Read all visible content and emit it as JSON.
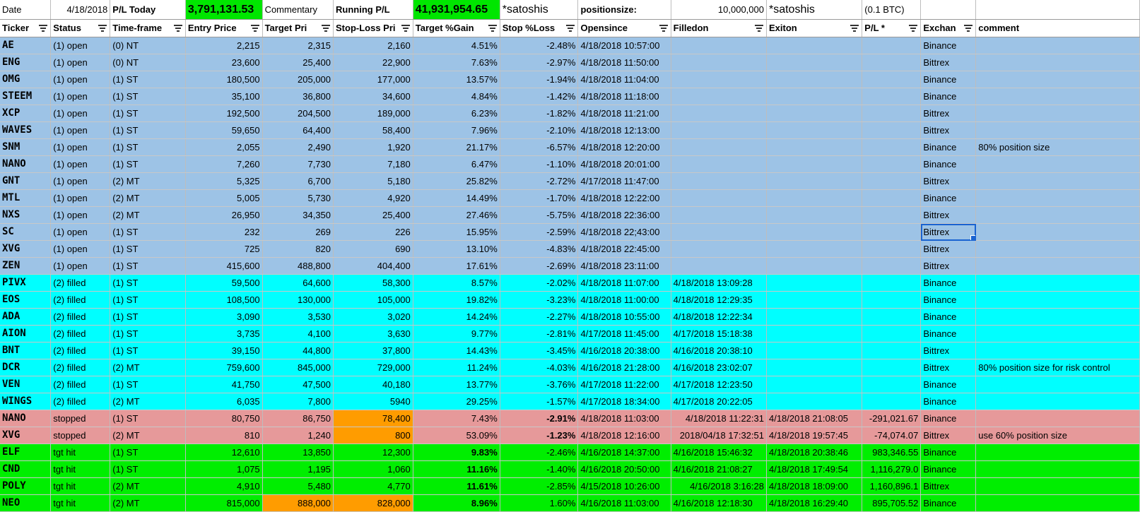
{
  "topbar": {
    "date_label": "Date",
    "date_value": "4/18/2018",
    "pl_today_label": "P/L Today",
    "pl_today_value": "3,791,131.53",
    "commentary_label": "Commentary",
    "running_pl_label": "Running P/L",
    "running_pl_value": "41,931,954.65",
    "satoshis_label_1": "*satoshis",
    "positionsize_label": "positionsize:",
    "positionsize_value": "10,000,000",
    "satoshis_label_2": "*satoshis",
    "btc_note": "(0.1 BTC)"
  },
  "colors": {
    "open": "#9dc3e6",
    "filled": "#00ffff",
    "stopped": "#e6999a",
    "tgt_hit": "#00ee00",
    "highlight": "#ff9c00",
    "header_green": "#00e600",
    "selection": "#1a63d1"
  },
  "headers": [
    "Ticker",
    "Status",
    "Time-frame",
    "Entry Price",
    "Target Pri",
    "Stop-Loss Pri",
    "Target %Gain",
    "Stop %Loss",
    "Opensince",
    "Filledon",
    "Exiton",
    "P/L *",
    "Exchan",
    "comment"
  ],
  "filter_icon": "autofilter-dropdown-icon",
  "rows": [
    {
      "ticker": "AE",
      "status": "(1) open",
      "timeframe": "(0) NT",
      "entry": "2,215",
      "target": "2,315",
      "stop": "2,160",
      "tgain": "4.51%",
      "sloss": "-2.48%",
      "opensince": "4/18/2018 10:57:00",
      "filledon": "",
      "exiton": "",
      "pl": "",
      "exchange": "Binance",
      "comment": ""
    },
    {
      "ticker": "ENG",
      "status": "(1) open",
      "timeframe": "(0) NT",
      "entry": "23,600",
      "target": "25,400",
      "stop": "22,900",
      "tgain": "7.63%",
      "sloss": "-2.97%",
      "opensince": "4/18/2018 11:50:00",
      "filledon": "",
      "exiton": "",
      "pl": "",
      "exchange": "Bittrex",
      "comment": ""
    },
    {
      "ticker": "OMG",
      "status": "(1) open",
      "timeframe": "(1) ST",
      "entry": "180,500",
      "target": "205,000",
      "stop": "177,000",
      "tgain": "13.57%",
      "sloss": "-1.94%",
      "opensince": "4/18/2018 11:04:00",
      "filledon": "",
      "exiton": "",
      "pl": "",
      "exchange": "Binance",
      "comment": ""
    },
    {
      "ticker": "STEEM",
      "status": "(1) open",
      "timeframe": "(1) ST",
      "entry": "35,100",
      "target": "36,800",
      "stop": "34,600",
      "tgain": "4.84%",
      "sloss": "-1.42%",
      "opensince": "4/18/2018 11:18:00",
      "filledon": "",
      "exiton": "",
      "pl": "",
      "exchange": "Binance",
      "comment": ""
    },
    {
      "ticker": "XCP",
      "status": "(1) open",
      "timeframe": "(1) ST",
      "entry": "192,500",
      "target": "204,500",
      "stop": "189,000",
      "tgain": "6.23%",
      "sloss": "-1.82%",
      "opensince": "4/18/2018 11:21:00",
      "filledon": "",
      "exiton": "",
      "pl": "",
      "exchange": "Bittrex",
      "comment": ""
    },
    {
      "ticker": "WAVES",
      "status": "(1) open",
      "timeframe": "(1) ST",
      "entry": "59,650",
      "target": "64,400",
      "stop": "58,400",
      "tgain": "7.96%",
      "sloss": "-2.10%",
      "opensince": "4/18/2018 12:13:00",
      "filledon": "",
      "exiton": "",
      "pl": "",
      "exchange": "Bittrex",
      "comment": ""
    },
    {
      "ticker": "SNM",
      "status": "(1) open",
      "timeframe": "(1) ST",
      "entry": "2,055",
      "target": "2,490",
      "stop": "1,920",
      "tgain": "21.17%",
      "sloss": "-6.57%",
      "opensince": "4/18/2018 12:20:00",
      "filledon": "",
      "exiton": "",
      "pl": "",
      "exchange": "Binance",
      "comment": "80% position size"
    },
    {
      "ticker": "NANO",
      "status": "(1) open",
      "timeframe": "(1) ST",
      "entry": "7,260",
      "target": "7,730",
      "stop": "7,180",
      "tgain": "6.47%",
      "sloss": "-1.10%",
      "opensince": "4/18/2018 20:01:00",
      "filledon": "",
      "exiton": "",
      "pl": "",
      "exchange": "Binance",
      "comment": ""
    },
    {
      "ticker": "GNT",
      "status": "(1) open",
      "timeframe": "(2) MT",
      "entry": "5,325",
      "target": "6,700",
      "stop": "5,180",
      "tgain": "25.82%",
      "sloss": "-2.72%",
      "opensince": "4/17/2018 11:47:00",
      "filledon": "",
      "exiton": "",
      "pl": "",
      "exchange": "Bittrex",
      "comment": ""
    },
    {
      "ticker": "MTL",
      "status": "(1) open",
      "timeframe": "(2) MT",
      "entry": "5,005",
      "target": "5,730",
      "stop": "4,920",
      "tgain": "14.49%",
      "sloss": "-1.70%",
      "opensince": "4/18/2018 12:22:00",
      "filledon": "",
      "exiton": "",
      "pl": "",
      "exchange": "Binance",
      "comment": ""
    },
    {
      "ticker": "NXS",
      "status": "(1) open",
      "timeframe": "(2) MT",
      "entry": "26,950",
      "target": "34,350",
      "stop": "25,400",
      "tgain": "27.46%",
      "sloss": "-5.75%",
      "opensince": "4/18/2018 22:36:00",
      "filledon": "",
      "exiton": "",
      "pl": "",
      "exchange": "Bittrex",
      "comment": ""
    },
    {
      "ticker": "SC",
      "status": "(1) open",
      "timeframe": "(1) ST",
      "entry": "232",
      "target": "269",
      "stop": "226",
      "tgain": "15.95%",
      "sloss": "-2.59%",
      "opensince": "4/18/2018 22;43:00",
      "filledon": "",
      "exiton": "",
      "pl": "",
      "exchange": "Bittrex",
      "comment": "",
      "selected": true
    },
    {
      "ticker": "XVG",
      "status": "(1) open",
      "timeframe": "(1) ST",
      "entry": "725",
      "target": "820",
      "stop": "690",
      "tgain": "13.10%",
      "sloss": "-4.83%",
      "opensince": "4/18/2018 22:45:00",
      "filledon": "",
      "exiton": "",
      "pl": "",
      "exchange": "Bittrex",
      "comment": ""
    },
    {
      "ticker": "ZEN",
      "status": "(1) open",
      "timeframe": "(1) ST",
      "entry": "415,600",
      "target": "488,800",
      "stop": "404,400",
      "tgain": "17.61%",
      "sloss": "-2.69%",
      "opensince": "4/18/2018 23:11:00",
      "filledon": "",
      "exiton": "",
      "pl": "",
      "exchange": "Bittrex",
      "comment": ""
    },
    {
      "ticker": "PIVX",
      "status": "(2) filled",
      "timeframe": "(1) ST",
      "entry": "59,500",
      "target": "64,600",
      "stop": "58,300",
      "tgain": "8.57%",
      "sloss": "-2.02%",
      "opensince": "4/18/2018 11:07:00",
      "filledon": "4/18/2018 13:09:28",
      "exiton": "",
      "pl": "",
      "exchange": "Binance",
      "comment": ""
    },
    {
      "ticker": "EOS",
      "status": "(2) filled",
      "timeframe": "(1) ST",
      "entry": "108,500",
      "target": "130,000",
      "stop": "105,000",
      "tgain": "19.82%",
      "sloss": "-3.23%",
      "opensince": "4/18/2018 11:00:00",
      "filledon": "4/18/2018 12:29:35",
      "exiton": "",
      "pl": "",
      "exchange": "Binance",
      "comment": ""
    },
    {
      "ticker": "ADA",
      "status": "(2) filled",
      "timeframe": "(1) ST",
      "entry": "3,090",
      "target": "3,530",
      "stop": "3,020",
      "tgain": "14.24%",
      "sloss": "-2.27%",
      "opensince": "4/18/2018 10:55:00",
      "filledon": "4/18/2018 12:22:34",
      "exiton": "",
      "pl": "",
      "exchange": "Binance",
      "comment": ""
    },
    {
      "ticker": "AION",
      "status": "(2) filled",
      "timeframe": "(1) ST",
      "entry": "3,735",
      "target": "4,100",
      "stop": "3,630",
      "tgain": "9.77%",
      "sloss": "-2.81%",
      "opensince": "4/17/2018 11:45:00",
      "filledon": "4/17/2018 15:18:38",
      "exiton": "",
      "pl": "",
      "exchange": "Binance",
      "comment": ""
    },
    {
      "ticker": "BNT",
      "status": "(2) filled",
      "timeframe": "(1) ST",
      "entry": "39,150",
      "target": "44,800",
      "stop": "37,800",
      "tgain": "14.43%",
      "sloss": "-3.45%",
      "opensince": "4/16/2018 20:38:00",
      "filledon": "4/16/2018 20:38:10",
      "exiton": "",
      "pl": "",
      "exchange": "Bittrex",
      "comment": ""
    },
    {
      "ticker": "DCR",
      "status": "(2) filled",
      "timeframe": "(2) MT",
      "entry": "759,600",
      "target": "845,000",
      "stop": "729,000",
      "tgain": "11.24%",
      "sloss": "-4.03%",
      "opensince": "4/16/2018 21:28:00",
      "filledon": "4/16/2018 23:02:07",
      "exiton": "",
      "pl": "",
      "exchange": "Bittrex",
      "comment": "80% position size for risk control"
    },
    {
      "ticker": "VEN",
      "status": "(2) filled",
      "timeframe": "(1) ST",
      "entry": "41,750",
      "target": "47,500",
      "stop": "40,180",
      "tgain": "13.77%",
      "sloss": "-3.76%",
      "opensince": "4/17/2018 11:22:00",
      "filledon": "4/17/2018 12:23:50",
      "exiton": "",
      "pl": "",
      "exchange": "Binance",
      "comment": ""
    },
    {
      "ticker": "WINGS",
      "status": "(2) filled",
      "timeframe": "(2) MT",
      "entry": "6,035",
      "target": "7,800",
      "stop": "5940",
      "tgain": "29.25%",
      "sloss": "-1.57%",
      "opensince": "4/17/2018 18:34:00",
      "filledon": "4/17/2018 20:22:05",
      "exiton": "",
      "pl": "",
      "exchange": "Binance",
      "comment": ""
    },
    {
      "ticker": "NANO",
      "status": "stopped",
      "timeframe": "(1) ST",
      "entry": "80,750",
      "target": "86,750",
      "stop": "78,400",
      "tgain": "7.43%",
      "sloss": "-2.91%",
      "opensince": "4/18/2018 11:03:00",
      "filledon": "4/18/2018 11:22:31",
      "exiton": "4/18/2018 21:08:05",
      "pl": "-291,021.67",
      "exchange": "Binance",
      "comment": "",
      "stop_orange": true,
      "sloss_bold": true
    },
    {
      "ticker": "XVG",
      "status": "stopped",
      "timeframe": "(2) MT",
      "entry": "810",
      "target": "1,240",
      "stop": "800",
      "tgain": "53.09%",
      "sloss": "-1.23%",
      "opensince": "4/18/2018 12:16:00",
      "filledon": "2018/04/18 17:32:51",
      "exiton": "4/18/2018 19:57:45",
      "pl": "-74,074.07",
      "exchange": "Bittrex",
      "comment": "use 60% position size",
      "stop_orange": true,
      "sloss_bold": true
    },
    {
      "ticker": "ELF",
      "status": "tgt hit",
      "timeframe": "(1) ST",
      "entry": "12,610",
      "target": "13,850",
      "stop": "12,300",
      "tgain": "9.83%",
      "sloss": "-2.46%",
      "opensince": "4/16/2018 14:37:00",
      "filledon": "4/16/2018 15:46:32",
      "exiton": "4/18/2018 20:38:46",
      "pl": "983,346.55",
      "exchange": "Binance",
      "comment": "",
      "tgain_bold": true
    },
    {
      "ticker": "CND",
      "status": "tgt hit",
      "timeframe": "(1) ST",
      "entry": "1,075",
      "target": "1,195",
      "stop": "1,060",
      "tgain": "11.16%",
      "sloss": "-1.40%",
      "opensince": "4/16/2018 20:50:00",
      "filledon": "4/16/2018 21:08:27",
      "exiton": "4/18/2018 17:49:54",
      "pl": "1,116,279.0",
      "exchange": "Binance",
      "comment": "",
      "tgain_bold": true
    },
    {
      "ticker": "POLY",
      "status": "tgt hit",
      "timeframe": "(2) MT",
      "entry": "4,910",
      "target": "5,480",
      "stop": "4,770",
      "tgain": "11.61%",
      "sloss": "-2.85%",
      "opensince": "4/15/2018 10:26:00",
      "filledon": "4/16/2018 3:16:28",
      "exiton": "4/18/2018 18:09:00",
      "pl": "1,160,896.1",
      "exchange": "Bittrex",
      "comment": "",
      "tgain_bold": true
    },
    {
      "ticker": "NEO",
      "status": "tgt hit",
      "timeframe": "(2) MT",
      "entry": "815,000",
      "target": "888,000",
      "stop": "828,000",
      "tgain": "8.96%",
      "sloss": "1.60%",
      "opensince": "4/16/2018 11:03:00",
      "filledon": "4/16/2018 12:18:30",
      "exiton": "4/18/2018 16:29:40",
      "pl": "895,705.52",
      "exchange": "Binance",
      "comment": "",
      "tgain_bold": true,
      "target_orange": true,
      "stop_orange": true
    }
  ]
}
